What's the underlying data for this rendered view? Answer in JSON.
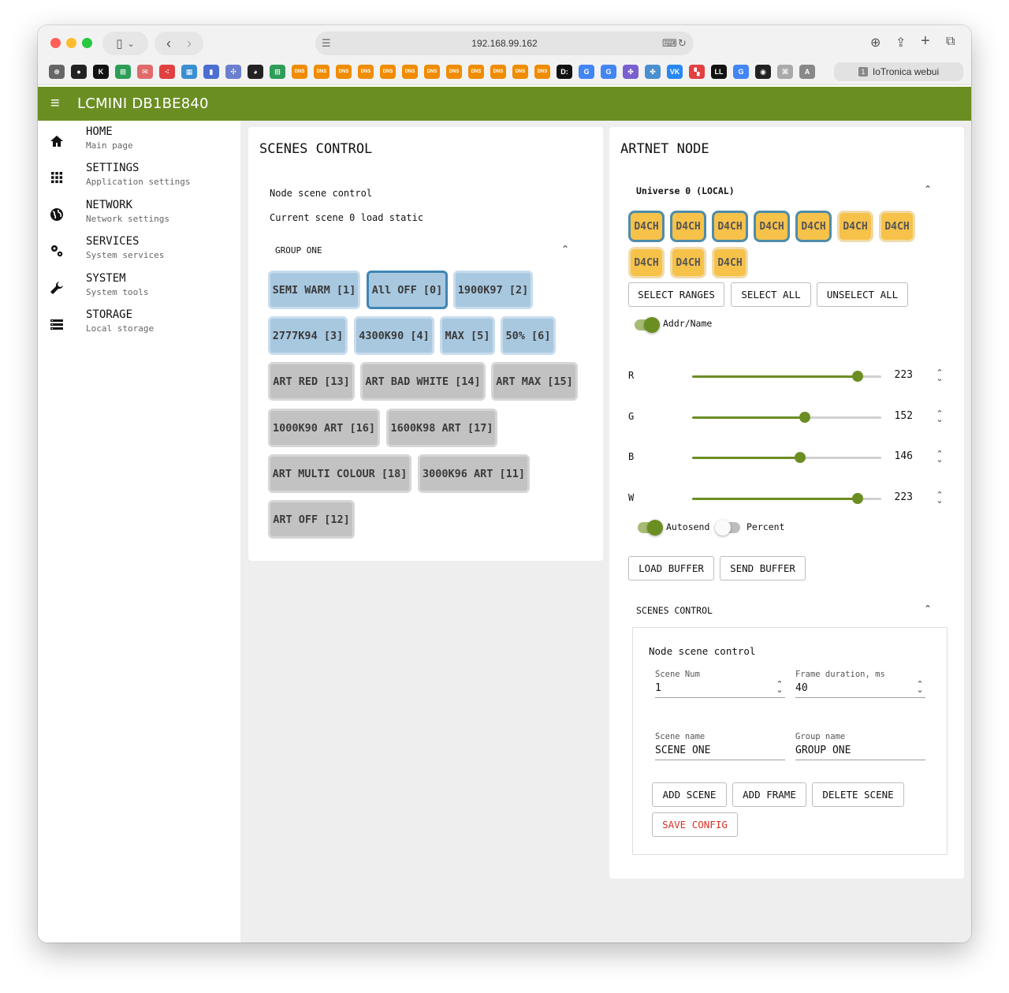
{
  "browser": {
    "url": "192.168.99.162",
    "tab_title": "IoTronica webui",
    "tab_favicon": "1",
    "bookmarks": [
      {
        "icon": "openai-icon",
        "color": "#666666",
        "text": "⊛"
      },
      {
        "icon": "circle-icon",
        "color": "#222222",
        "text": "●"
      },
      {
        "icon": "k-icon",
        "color": "#111111",
        "text": "K"
      },
      {
        "icon": "sheets-icon",
        "color": "#2e9e57",
        "text": "⊞"
      },
      {
        "icon": "mail-icon",
        "color": "#e06a6a",
        "text": "✉"
      },
      {
        "icon": "dots-icon",
        "color": "#e04040",
        "text": "⁖"
      },
      {
        "icon": "chart-icon",
        "color": "#3a8fd0",
        "text": "▦"
      },
      {
        "icon": "bars-icon",
        "color": "#4a6fd0",
        "text": "▮"
      },
      {
        "icon": "network-icon",
        "color": "#6a7fd0",
        "text": "✣"
      },
      {
        "icon": "gauge-icon",
        "color": "#222222",
        "text": "◕"
      },
      {
        "icon": "sheets2-icon",
        "color": "#2e9e57",
        "text": "⊞"
      },
      {
        "icon": "dns-icon",
        "color": "#f08c00",
        "text": "DNS"
      },
      {
        "icon": "dns-icon",
        "color": "#f08c00",
        "text": "DNS"
      },
      {
        "icon": "dns-icon",
        "color": "#f08c00",
        "text": "DNS"
      },
      {
        "icon": "dns-icon",
        "color": "#f08c00",
        "text": "DNS"
      },
      {
        "icon": "dns-icon",
        "color": "#f08c00",
        "text": "DNS"
      },
      {
        "icon": "dns-icon",
        "color": "#f08c00",
        "text": "DNS"
      },
      {
        "icon": "dns-icon",
        "color": "#f08c00",
        "text": "DNS"
      },
      {
        "icon": "dns-icon",
        "color": "#f08c00",
        "text": "DNS"
      },
      {
        "icon": "dns-icon",
        "color": "#f08c00",
        "text": "DNS"
      },
      {
        "icon": "dns-icon",
        "color": "#f08c00",
        "text": "DNS"
      },
      {
        "icon": "dns-icon",
        "color": "#f08c00",
        "text": "DNS"
      },
      {
        "icon": "dns-icon",
        "color": "#f08c00",
        "text": "DNS"
      },
      {
        "icon": "d-icon",
        "color": "#111111",
        "text": "D:"
      },
      {
        "icon": "google-icon",
        "color": "#4285f4",
        "text": "G"
      },
      {
        "icon": "google-icon",
        "color": "#4285f4",
        "text": "G"
      },
      {
        "icon": "apps-icon",
        "color": "#7a5fd0",
        "text": "✤"
      },
      {
        "icon": "apps-icon",
        "color": "#4a8fd0",
        "text": "✤"
      },
      {
        "icon": "vk-icon",
        "color": "#2787f5",
        "text": "VK"
      },
      {
        "icon": "grid-icon",
        "color": "#e04040",
        "text": "▚"
      },
      {
        "icon": "ll-icon",
        "color": "#111111",
        "text": "LL"
      },
      {
        "icon": "google-icon",
        "color": "#4285f4",
        "text": "G"
      },
      {
        "icon": "github-icon",
        "color": "#222222",
        "text": "◉"
      },
      {
        "icon": "cmd-icon",
        "color": "#aaaaaa",
        "text": "⌘"
      },
      {
        "icon": "a-icon",
        "color": "#888888",
        "text": "A"
      }
    ]
  },
  "app": {
    "title": "LCMINI DB1BE840"
  },
  "sidebar": {
    "items": [
      {
        "label": "HOME",
        "sub": "Main page",
        "icon": "home-icon"
      },
      {
        "label": "SETTINGS",
        "sub": "Application settings",
        "icon": "apps-grid-icon"
      },
      {
        "label": "NETWORK",
        "sub": "Network settings",
        "icon": "globe-icon"
      },
      {
        "label": "SERVICES",
        "sub": "System services",
        "icon": "gears-icon"
      },
      {
        "label": "SYSTEM",
        "sub": "System tools",
        "icon": "wrench-icon"
      },
      {
        "label": "STORAGE",
        "sub": "Local storage",
        "icon": "storage-icon"
      }
    ]
  },
  "scenes_card": {
    "title": "SCENES CONTROL",
    "subtitle": "Node scene control",
    "status": "Current scene 0 load static",
    "group_label": "GROUP ONE",
    "scenes": [
      {
        "label": "SEMI WARM [1]",
        "style": "blue",
        "active": false
      },
      {
        "label": "All OFF [0]",
        "style": "blue",
        "active": true
      },
      {
        "label": "1900K97 [2]",
        "style": "blue",
        "active": false
      },
      {
        "label": "2777K94 [3]",
        "style": "blue",
        "active": false
      },
      {
        "label": "4300K90 [4]",
        "style": "blue",
        "active": false
      },
      {
        "label": "MAX [5]",
        "style": "blue",
        "active": false
      },
      {
        "label": "50% [6]",
        "style": "blue",
        "active": false
      },
      {
        "label": "ART RED [13]",
        "style": "gray",
        "active": false
      },
      {
        "label": "ART BAD WHITE [14]",
        "style": "gray",
        "active": false
      },
      {
        "label": "ART MAX [15]",
        "style": "gray",
        "active": false
      },
      {
        "label": "1000K90 ART [16]",
        "style": "gray",
        "active": false
      },
      {
        "label": "1600K98 ART [17]",
        "style": "gray",
        "active": false
      },
      {
        "label": "ART MULTI COLOUR [18]",
        "style": "gray",
        "active": false
      },
      {
        "label": "3000K96 ART [11]",
        "style": "gray",
        "active": false
      },
      {
        "label": "ART OFF [12]",
        "style": "gray",
        "active": false
      }
    ]
  },
  "artnet_card": {
    "title": "ARTNET NODE",
    "universe_label": "Universe 0 (LOCAL)",
    "devices": [
      {
        "label": "D4CH",
        "selected": true
      },
      {
        "label": "D4CH",
        "selected": true
      },
      {
        "label": "D4CH",
        "selected": true
      },
      {
        "label": "D4CH",
        "selected": true
      },
      {
        "label": "D4CH",
        "selected": true
      },
      {
        "label": "D4CH",
        "selected": false
      },
      {
        "label": "D4CH",
        "selected": false
      },
      {
        "label": "D4CH",
        "selected": false
      },
      {
        "label": "D4CH",
        "selected": false
      },
      {
        "label": "D4CH",
        "selected": false
      }
    ],
    "select_ranges": "SELECT RANGES",
    "select_all": "SELECT ALL",
    "unselect_all": "UNSELECT ALL",
    "addr_toggle_label": "Addr/Name",
    "addr_toggle_on": true,
    "channels": [
      {
        "name": "R",
        "value": 223,
        "max": 255
      },
      {
        "name": "G",
        "value": 152,
        "max": 255
      },
      {
        "name": "B",
        "value": 146,
        "max": 255
      },
      {
        "name": "W",
        "value": 223,
        "max": 255
      }
    ],
    "autosend_label": "Autosend",
    "autosend_on": true,
    "percent_label": "Percent",
    "percent_on": false,
    "load_buffer": "LOAD BUFFER",
    "send_buffer": "SEND BUFFER",
    "scenes_section": {
      "title": "SCENES CONTROL",
      "subtitle": "Node scene control",
      "scene_num_label": "Scene Num",
      "scene_num_value": "1",
      "frame_duration_label": "Frame duration, ms",
      "frame_duration_value": "40",
      "scene_name_label": "Scene name",
      "scene_name_value": "SCENE ONE",
      "group_name_label": "Group name",
      "group_name_value": "GROUP ONE",
      "add_scene": "ADD SCENE",
      "add_frame": "ADD FRAME",
      "delete_scene": "DELETE SCENE",
      "save_config": "SAVE CONFIG"
    }
  },
  "colors": {
    "accent": "#6b8e23",
    "scene_blue": "#a8c8e0",
    "scene_active_border": "#3f86b4",
    "scene_gray": "#c2c2c2",
    "device_yellow": "#f7c24a",
    "device_selected_border": "#4f8ca8",
    "danger": "#d93025"
  }
}
